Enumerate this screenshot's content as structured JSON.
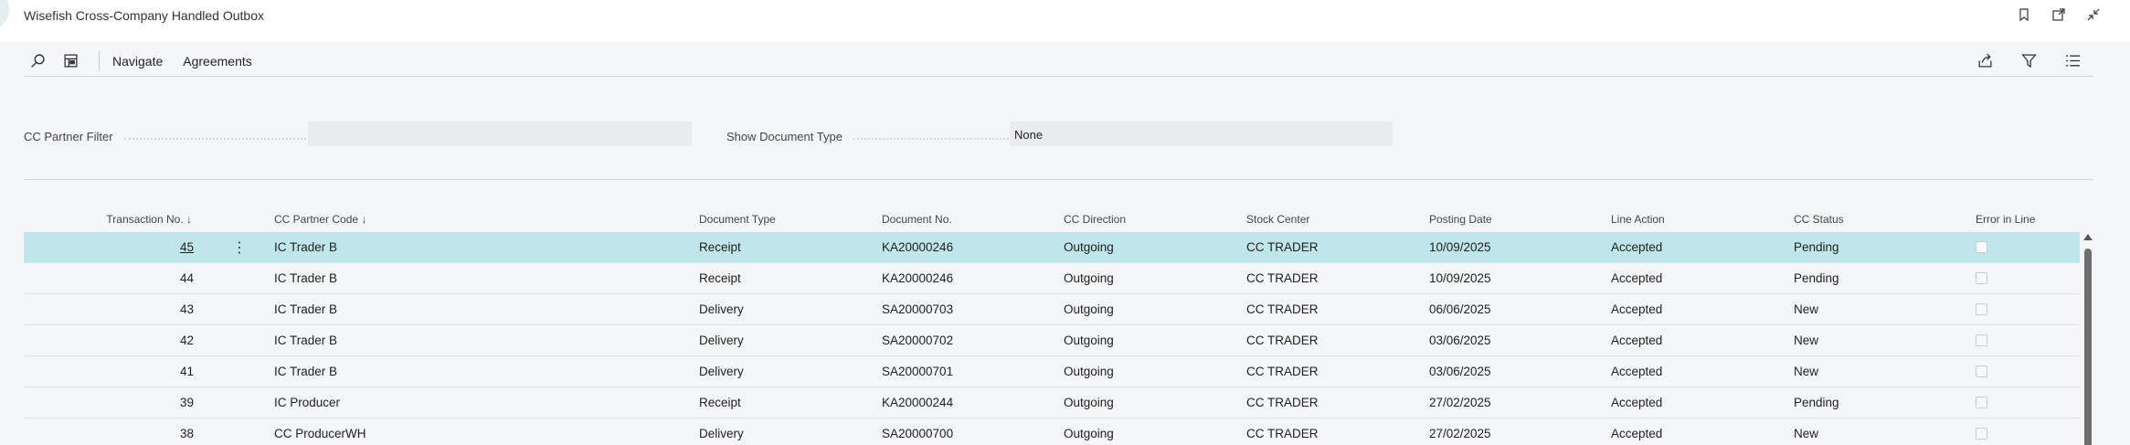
{
  "window": {
    "title": "Wisefish Cross-Company Handled Outbox"
  },
  "actions": {
    "navigate": "Navigate",
    "agreements": "Agreements"
  },
  "filters": {
    "partner_label": "CC Partner Filter",
    "partner_value": "",
    "doctype_label": "Show Document Type",
    "doctype_value": "None"
  },
  "grid": {
    "headers": {
      "transaction_no": "Transaction No. ↓",
      "partner_code": "CC Partner Code ↓",
      "document_type": "Document Type",
      "document_no": "Document No.",
      "direction": "CC Direction",
      "stock_center": "Stock Center",
      "posting_date": "Posting Date",
      "line_action": "Line Action",
      "status": "CC Status",
      "error": "Error in Line"
    },
    "rows": [
      {
        "transaction_no": "45",
        "partner_code": "IC Trader B",
        "document_type": "Receipt",
        "document_no": "KA20000246",
        "direction": "Outgoing",
        "stock_center": "CC TRADER",
        "posting_date": "10/09/2025",
        "line_action": "Accepted",
        "status": "Pending"
      },
      {
        "transaction_no": "44",
        "partner_code": "IC Trader B",
        "document_type": "Receipt",
        "document_no": "KA20000246",
        "direction": "Outgoing",
        "stock_center": "CC TRADER",
        "posting_date": "10/09/2025",
        "line_action": "Accepted",
        "status": "Pending"
      },
      {
        "transaction_no": "43",
        "partner_code": "IC Trader B",
        "document_type": "Delivery",
        "document_no": "SA20000703",
        "direction": "Outgoing",
        "stock_center": "CC TRADER",
        "posting_date": "06/06/2025",
        "line_action": "Accepted",
        "status": "New"
      },
      {
        "transaction_no": "42",
        "partner_code": "IC Trader B",
        "document_type": "Delivery",
        "document_no": "SA20000702",
        "direction": "Outgoing",
        "stock_center": "CC TRADER",
        "posting_date": "03/06/2025",
        "line_action": "Accepted",
        "status": "New"
      },
      {
        "transaction_no": "41",
        "partner_code": "IC Trader B",
        "document_type": "Delivery",
        "document_no": "SA20000701",
        "direction": "Outgoing",
        "stock_center": "CC TRADER",
        "posting_date": "03/06/2025",
        "line_action": "Accepted",
        "status": "New"
      },
      {
        "transaction_no": "39",
        "partner_code": "IC Producer",
        "document_type": "Receipt",
        "document_no": "KA20000244",
        "direction": "Outgoing",
        "stock_center": "CC TRADER",
        "posting_date": "27/02/2025",
        "line_action": "Accepted",
        "status": "Pending"
      },
      {
        "transaction_no": "38",
        "partner_code": "CC ProducerWH",
        "document_type": "Delivery",
        "document_no": "SA20000700",
        "direction": "Outgoing",
        "stock_center": "CC TRADER",
        "posting_date": "27/02/2025",
        "line_action": "Accepted",
        "status": "New"
      }
    ]
  },
  "icons": {
    "title": [
      "bookmark-icon",
      "open-new-window-icon",
      "collapse-icon"
    ],
    "action_left": [
      "search-icon",
      "list-view-icon"
    ],
    "action_right": [
      "share-icon",
      "filter-icon",
      "list-options-icon"
    ]
  },
  "colors": {
    "selected_row": "#bfe6ea",
    "background": "#f5f6f7",
    "input_bg": "#eaebec"
  }
}
